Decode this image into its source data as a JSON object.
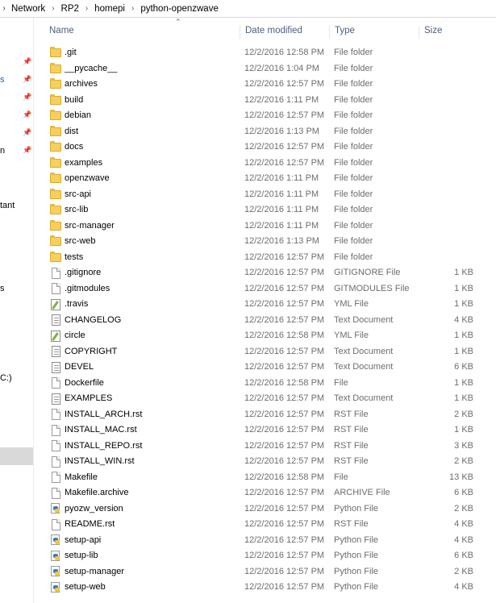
{
  "breadcrumb": [
    "Network",
    "RP2",
    "homepi",
    "python-openzwave"
  ],
  "columns": {
    "name": "Name",
    "date": "Date modified",
    "type": "Type",
    "size": "Size"
  },
  "leftnav_fragments": [
    "s",
    "n",
    "tant",
    "s",
    "C:)"
  ],
  "files": [
    {
      "name": ".git",
      "date": "12/2/2016 12:58 PM",
      "type": "File folder",
      "size": "",
      "icon": "folder-icon"
    },
    {
      "name": "__pycache__",
      "date": "12/2/2016 1:04 PM",
      "type": "File folder",
      "size": "",
      "icon": "folder-icon"
    },
    {
      "name": "archives",
      "date": "12/2/2016 12:57 PM",
      "type": "File folder",
      "size": "",
      "icon": "folder-icon"
    },
    {
      "name": "build",
      "date": "12/2/2016 1:11 PM",
      "type": "File folder",
      "size": "",
      "icon": "folder-icon"
    },
    {
      "name": "debian",
      "date": "12/2/2016 12:57 PM",
      "type": "File folder",
      "size": "",
      "icon": "folder-icon"
    },
    {
      "name": "dist",
      "date": "12/2/2016 1:13 PM",
      "type": "File folder",
      "size": "",
      "icon": "folder-icon"
    },
    {
      "name": "docs",
      "date": "12/2/2016 12:57 PM",
      "type": "File folder",
      "size": "",
      "icon": "folder-icon"
    },
    {
      "name": "examples",
      "date": "12/2/2016 12:57 PM",
      "type": "File folder",
      "size": "",
      "icon": "folder-icon"
    },
    {
      "name": "openzwave",
      "date": "12/2/2016 1:11 PM",
      "type": "File folder",
      "size": "",
      "icon": "folder-icon"
    },
    {
      "name": "src-api",
      "date": "12/2/2016 1:11 PM",
      "type": "File folder",
      "size": "",
      "icon": "folder-icon"
    },
    {
      "name": "src-lib",
      "date": "12/2/2016 1:11 PM",
      "type": "File folder",
      "size": "",
      "icon": "folder-icon"
    },
    {
      "name": "src-manager",
      "date": "12/2/2016 1:11 PM",
      "type": "File folder",
      "size": "",
      "icon": "folder-icon"
    },
    {
      "name": "src-web",
      "date": "12/2/2016 1:13 PM",
      "type": "File folder",
      "size": "",
      "icon": "folder-icon"
    },
    {
      "name": "tests",
      "date": "12/2/2016 12:57 PM",
      "type": "File folder",
      "size": "",
      "icon": "folder-icon"
    },
    {
      "name": ".gitignore",
      "date": "12/2/2016 12:57 PM",
      "type": "GITIGNORE File",
      "size": "1 KB",
      "icon": "file-icon"
    },
    {
      "name": ".gitmodules",
      "date": "12/2/2016 12:57 PM",
      "type": "GITMODULES File",
      "size": "1 KB",
      "icon": "file-icon"
    },
    {
      "name": ".travis",
      "date": "12/2/2016 12:57 PM",
      "type": "YML File",
      "size": "1 KB",
      "icon": "yml-icon"
    },
    {
      "name": "CHANGELOG",
      "date": "12/2/2016 12:57 PM",
      "type": "Text Document",
      "size": "4 KB",
      "icon": "text-icon"
    },
    {
      "name": "circle",
      "date": "12/2/2016 12:58 PM",
      "type": "YML File",
      "size": "1 KB",
      "icon": "yml-icon"
    },
    {
      "name": "COPYRIGHT",
      "date": "12/2/2016 12:57 PM",
      "type": "Text Document",
      "size": "1 KB",
      "icon": "text-icon"
    },
    {
      "name": "DEVEL",
      "date": "12/2/2016 12:57 PM",
      "type": "Text Document",
      "size": "6 KB",
      "icon": "text-icon"
    },
    {
      "name": "Dockerfile",
      "date": "12/2/2016 12:58 PM",
      "type": "File",
      "size": "1 KB",
      "icon": "file-icon"
    },
    {
      "name": "EXAMPLES",
      "date": "12/2/2016 12:57 PM",
      "type": "Text Document",
      "size": "1 KB",
      "icon": "text-icon"
    },
    {
      "name": "INSTALL_ARCH.rst",
      "date": "12/2/2016 12:57 PM",
      "type": "RST File",
      "size": "2 KB",
      "icon": "file-icon"
    },
    {
      "name": "INSTALL_MAC.rst",
      "date": "12/2/2016 12:57 PM",
      "type": "RST File",
      "size": "1 KB",
      "icon": "file-icon"
    },
    {
      "name": "INSTALL_REPO.rst",
      "date": "12/2/2016 12:57 PM",
      "type": "RST File",
      "size": "3 KB",
      "icon": "file-icon"
    },
    {
      "name": "INSTALL_WIN.rst",
      "date": "12/2/2016 12:57 PM",
      "type": "RST File",
      "size": "2 KB",
      "icon": "file-icon"
    },
    {
      "name": "Makefile",
      "date": "12/2/2016 12:58 PM",
      "type": "File",
      "size": "13 KB",
      "icon": "file-icon"
    },
    {
      "name": "Makefile.archive",
      "date": "12/2/2016 12:57 PM",
      "type": "ARCHIVE File",
      "size": "6 KB",
      "icon": "file-icon"
    },
    {
      "name": "pyozw_version",
      "date": "12/2/2016 12:57 PM",
      "type": "Python File",
      "size": "2 KB",
      "icon": "python-icon"
    },
    {
      "name": "README.rst",
      "date": "12/2/2016 12:57 PM",
      "type": "RST File",
      "size": "4 KB",
      "icon": "file-icon"
    },
    {
      "name": "setup-api",
      "date": "12/2/2016 12:57 PM",
      "type": "Python File",
      "size": "4 KB",
      "icon": "python-icon"
    },
    {
      "name": "setup-lib",
      "date": "12/2/2016 12:57 PM",
      "type": "Python File",
      "size": "6 KB",
      "icon": "python-icon"
    },
    {
      "name": "setup-manager",
      "date": "12/2/2016 12:57 PM",
      "type": "Python File",
      "size": "2 KB",
      "icon": "python-icon"
    },
    {
      "name": "setup-web",
      "date": "12/2/2016 12:57 PM",
      "type": "Python File",
      "size": "4 KB",
      "icon": "python-icon"
    }
  ]
}
